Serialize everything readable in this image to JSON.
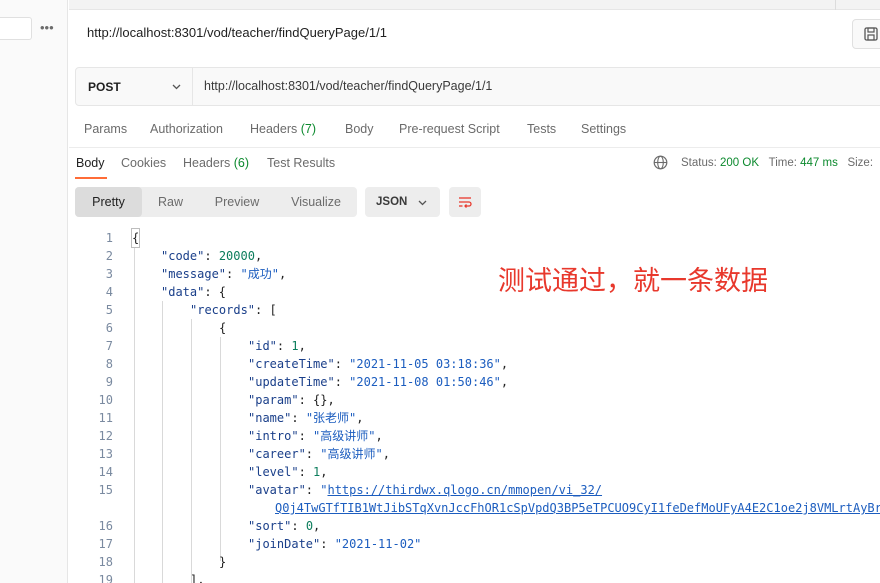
{
  "header": {
    "url_title": "http://localhost:8301/vod/teacher/findQueryPage/1/1"
  },
  "request": {
    "method": "POST",
    "url": "http://localhost:8301/vod/teacher/findQueryPage/1/1",
    "tabs": {
      "params": "Params",
      "authorization": "Authorization",
      "headers": "Headers",
      "headers_count": "(7)",
      "body": "Body",
      "prerequest": "Pre-request Script",
      "tests": "Tests",
      "settings": "Settings"
    }
  },
  "response": {
    "tabs": {
      "body": "Body",
      "cookies": "Cookies",
      "headers": "Headers",
      "headers_count": "(6)",
      "test_results": "Test Results"
    },
    "status_label": "Status:",
    "status_value": "200 OK",
    "time_label": "Time:",
    "time_value": "447 ms",
    "size_label": "Size:",
    "view_modes": {
      "pretty": "Pretty",
      "raw": "Raw",
      "preview": "Preview",
      "visualize": "Visualize"
    },
    "format": "JSON"
  },
  "code": {
    "line_numbers": [
      "1",
      "2",
      "3",
      "4",
      "5",
      "6",
      "7",
      "8",
      "9",
      "10",
      "11",
      "12",
      "13",
      "14",
      "15",
      "",
      "16",
      "17",
      "18",
      "19"
    ],
    "l1": "{",
    "l2_key": "\"code\"",
    "l2_val": "20000",
    "l3_key": "\"message\"",
    "l3_val": "\"成功\"",
    "l4_key": "\"data\"",
    "l4_rest": ": {",
    "l5_key": "\"records\"",
    "l5_rest": ": [",
    "l6": "{",
    "l7_key": "\"id\"",
    "l7_val": "1",
    "l8_key": "\"createTime\"",
    "l8_val": "\"2021-11-05 03:18:36\"",
    "l9_key": "\"updateTime\"",
    "l9_val": "\"2021-11-08 01:50:46\"",
    "l10_key": "\"param\"",
    "l10_rest": ": {},",
    "l11_key": "\"name\"",
    "l11_val": "\"张老师\"",
    "l12_key": "\"intro\"",
    "l12_val": "\"高级讲师\"",
    "l13_key": "\"career\"",
    "l13_val": "\"高级讲师\"",
    "l14_key": "\"level\"",
    "l14_val": "1",
    "l15_key": "\"avatar\"",
    "l15_quote": "\"",
    "l15_url1": "https://thirdwx.qlogo.cn/mmopen/vi_32/",
    "l15_url2": "Q0j4TwGTfTIB1WtJibSTqXvnJccFhOR1cSpVpdQ3BP5eTPCUO9CyI1feDefMoUFyA4E2C1oe2j8VMLrtAyBr",
    "l16_key": "\"sort\"",
    "l16_val": "0",
    "l17_key": "\"joinDate\"",
    "l17_val": "\"2021-11-02\"",
    "l18": "}",
    "l19": "],"
  },
  "annotation": "测试通过，就一条数据",
  "colors": {
    "accent": "#ff6c37",
    "success": "#0c8a2e",
    "annotation": "#e8382c"
  },
  "icons": [
    "more-dots-icon",
    "save-icon",
    "chevron-down-icon",
    "globe-icon",
    "wrap-lines-icon"
  ]
}
